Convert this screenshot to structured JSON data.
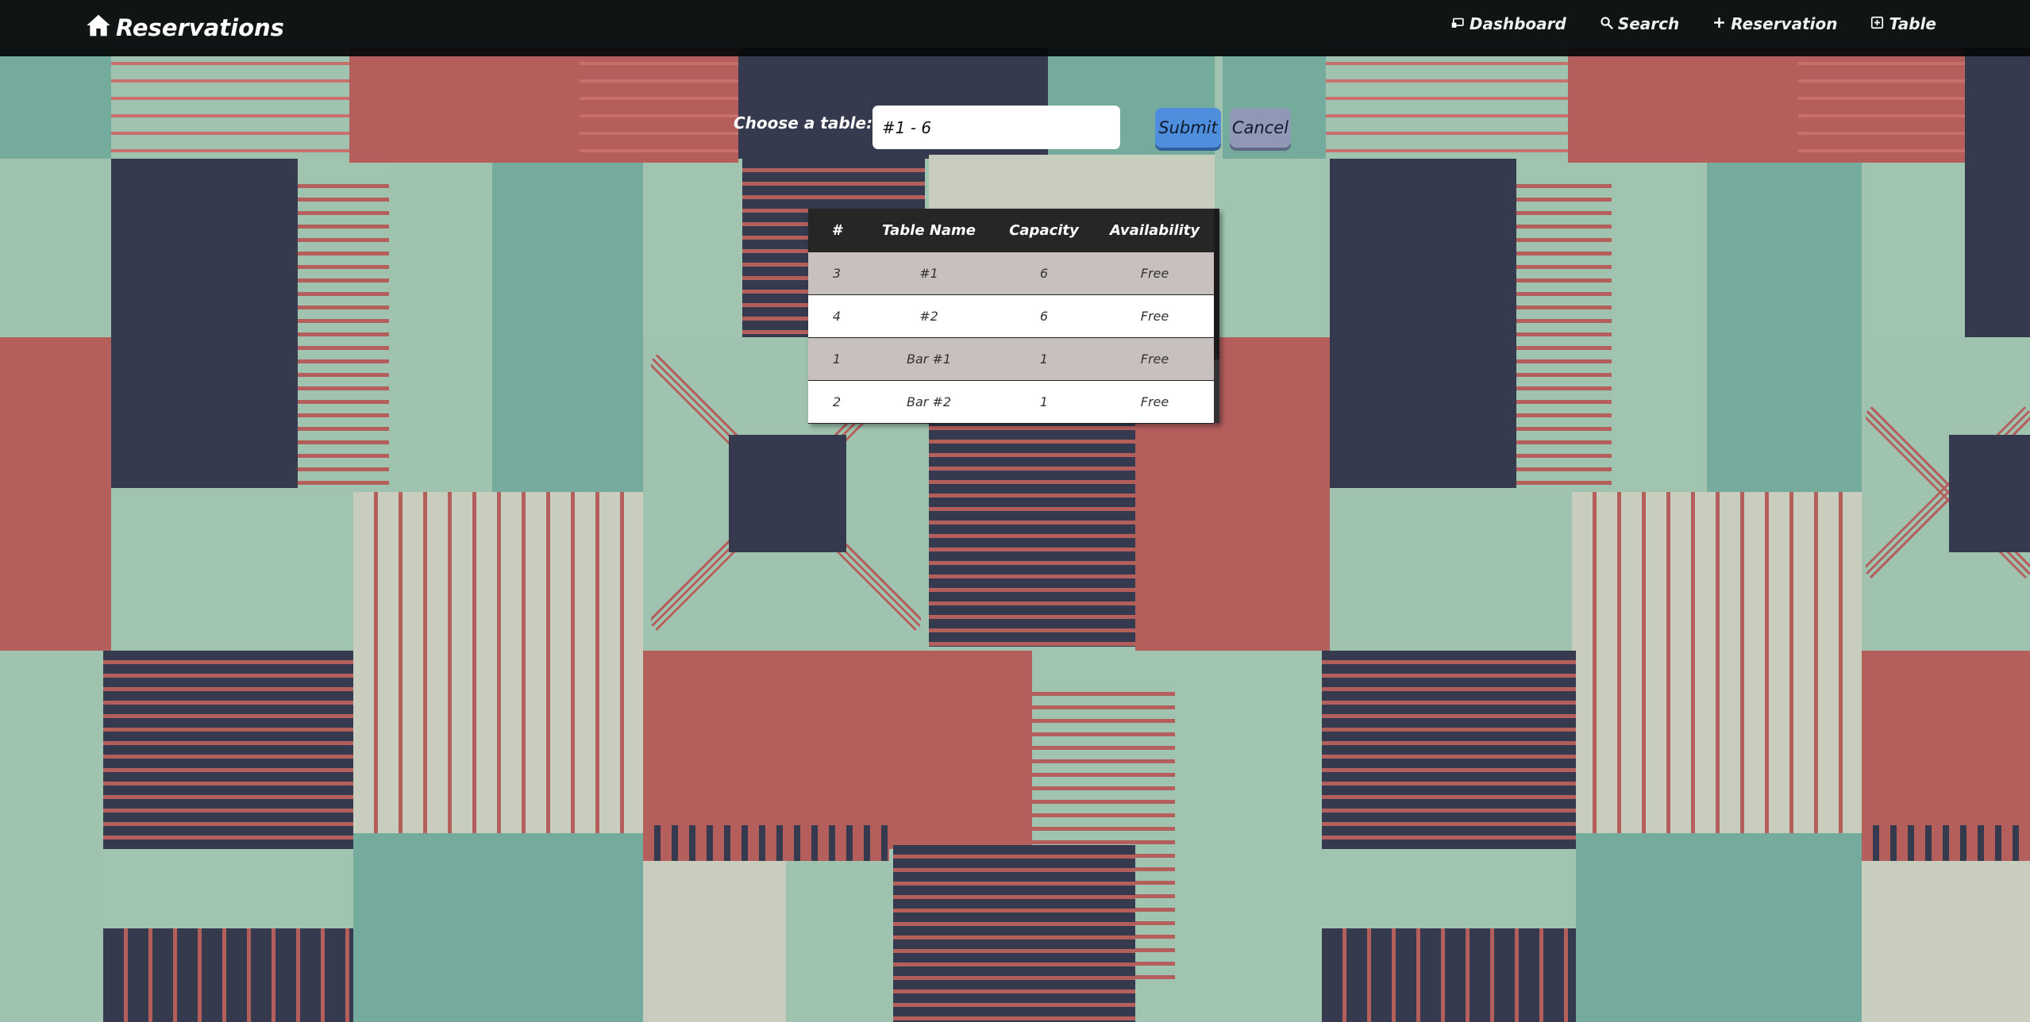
{
  "app": {
    "brand": "Reservations",
    "brand_icon": "home-icon"
  },
  "nav": [
    {
      "label": "Dashboard",
      "icon": "dashboard-icon"
    },
    {
      "label": "Search",
      "icon": "search-icon"
    },
    {
      "label": "Reservation",
      "icon": "plus-icon"
    },
    {
      "label": "Table",
      "icon": "plus-square-icon"
    }
  ],
  "form": {
    "label": "Choose a table:",
    "selected": "#1 - 6",
    "submit_label": "Submit",
    "cancel_label": "Cancel"
  },
  "table": {
    "headers": [
      "#",
      "Table Name",
      "Capacity",
      "Availability"
    ],
    "rows": [
      [
        "3",
        "#1",
        "6",
        "Free"
      ],
      [
        "4",
        "#2",
        "6",
        "Free"
      ],
      [
        "1",
        "Bar #1",
        "1",
        "Free"
      ],
      [
        "2",
        "Bar #2",
        "1",
        "Free"
      ]
    ]
  },
  "colors": {
    "navbar": "#06080a",
    "submit": "#4f8edc",
    "cancel": "#8f98b4",
    "row_shaded": "#c8bfbf",
    "header": "#262626"
  }
}
